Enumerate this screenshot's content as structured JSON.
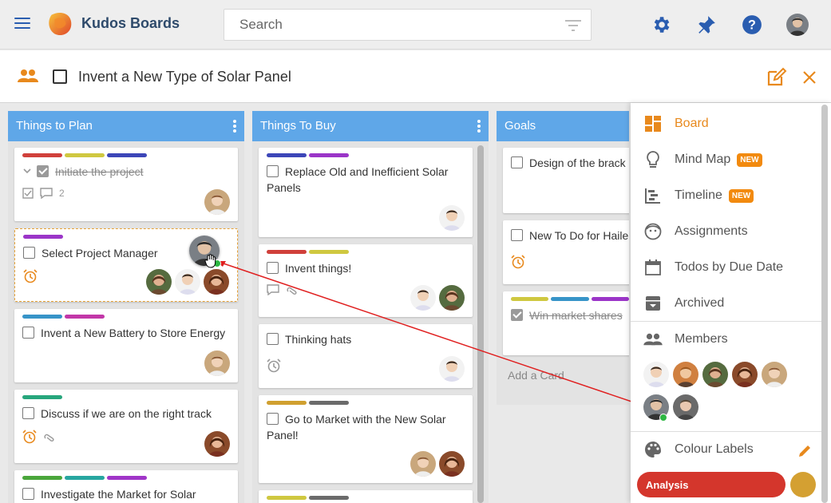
{
  "app": {
    "title": "Kudos Boards"
  },
  "search": {
    "placeholder": "Search"
  },
  "board": {
    "title": "Invent a New Type of Solar Panel"
  },
  "columns": [
    {
      "title": "Things to Plan",
      "cards": [
        {
          "title": "Initiate the project",
          "done": true,
          "labels": [
            "#d0403b",
            "#cfc840",
            "#3c46b8"
          ],
          "comments": "2"
        },
        {
          "title": "Select Project Manager",
          "done": false,
          "labels": [
            "#9b35c8"
          ]
        },
        {
          "title": "Invent a New Battery to Store Energy",
          "done": false,
          "labels": [
            "#3794c8",
            "#c237a8"
          ]
        },
        {
          "title": "Discuss if we are on the right track",
          "done": false,
          "labels": [
            "#27a67c"
          ]
        },
        {
          "title": "Investigate the Market for Solar",
          "done": false,
          "labels": [
            "#4aa63b",
            "#27a6a0",
            "#a035c8"
          ]
        }
      ]
    },
    {
      "title": "Things To Buy",
      "cards": [
        {
          "title": "Replace Old and Inefficient Solar Panels",
          "done": false,
          "labels": [
            "#3c46b8",
            "#9b35c8"
          ]
        },
        {
          "title": "Invent things!",
          "done": false,
          "labels": [
            "#d0403b",
            "#cfc840"
          ]
        },
        {
          "title": "Thinking hats",
          "done": false,
          "labels": []
        },
        {
          "title": "Go to Market with the New Solar Panel!",
          "done": false,
          "labels": [
            "#d0a030",
            "#6b6b6b"
          ]
        }
      ]
    },
    {
      "title": "Goals",
      "cards": [
        {
          "title": "Design of the brack",
          "done": false,
          "labels": []
        },
        {
          "title": "New To Do for Haile",
          "done": false,
          "labels": []
        },
        {
          "title": "Win market shares",
          "done": true,
          "labels": [
            "#cfc840",
            "#3794c8",
            "#9b35c8"
          ]
        }
      ],
      "add_card": "Add a Card"
    }
  ],
  "panel": {
    "views": [
      {
        "label": "Board",
        "icon": "board-icon",
        "active": true
      },
      {
        "label": "Mind Map",
        "icon": "lightbulb-icon",
        "badge": "NEW"
      },
      {
        "label": "Timeline",
        "icon": "timeline-icon",
        "badge": "NEW"
      },
      {
        "label": "Assignments",
        "icon": "assignments-icon"
      },
      {
        "label": "Todos by Due Date",
        "icon": "calendar-icon"
      },
      {
        "label": "Archived",
        "icon": "archive-icon"
      }
    ],
    "members_label": "Members",
    "colour_labels": "Colour Labels",
    "label_name": "Analysis"
  },
  "colors": {
    "accent": "#e8891d",
    "column_header": "#5fa7e8",
    "brand": "#2e4a6b",
    "icon_blue": "#2a5db0"
  }
}
